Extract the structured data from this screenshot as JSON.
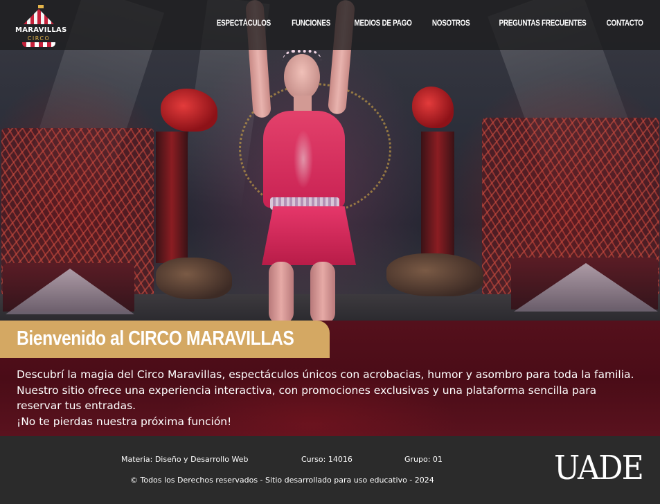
{
  "brand": {
    "logo_text": "MARAVILLAS",
    "logo_sub": "CIRCO"
  },
  "nav": {
    "items": [
      {
        "label": "ESPECTÁCULOS"
      },
      {
        "label": "FUNCIONES"
      },
      {
        "label": "MEDIOS DE PAGO"
      },
      {
        "label": "NOSOTROS"
      },
      {
        "label": "PREGUNTAS FRECUENTES"
      },
      {
        "label": "CONTACTO"
      }
    ]
  },
  "welcome": {
    "title": "Bienvenido al CIRCO MARAVILLAS",
    "body": "Descubrí la magia del Circo Maravillas, espectáculos únicos con acrobacias, humor y asombro para toda la familia. Nuestro sitio ofrece una experiencia interactiva, con promociones exclusivas y una plataforma sencilla para reservar tus entradas.",
    "cta_line": "¡No te pierdas nuestra próxima función!"
  },
  "footer": {
    "materia": "Materia: Diseño y Desarrollo Web",
    "curso": "Curso: 14016",
    "grupo": "Grupo: 01",
    "copyright": "© Todos los Derechos reservados - Sitio desarrollado para uso educativo - 2024",
    "university_logo": "UADE"
  },
  "colors": {
    "accent_gold": "#d4a863",
    "welcome_bg": "#4a0c17",
    "footer_bg": "#2b2b2b",
    "logo_red": "#c5213a"
  }
}
